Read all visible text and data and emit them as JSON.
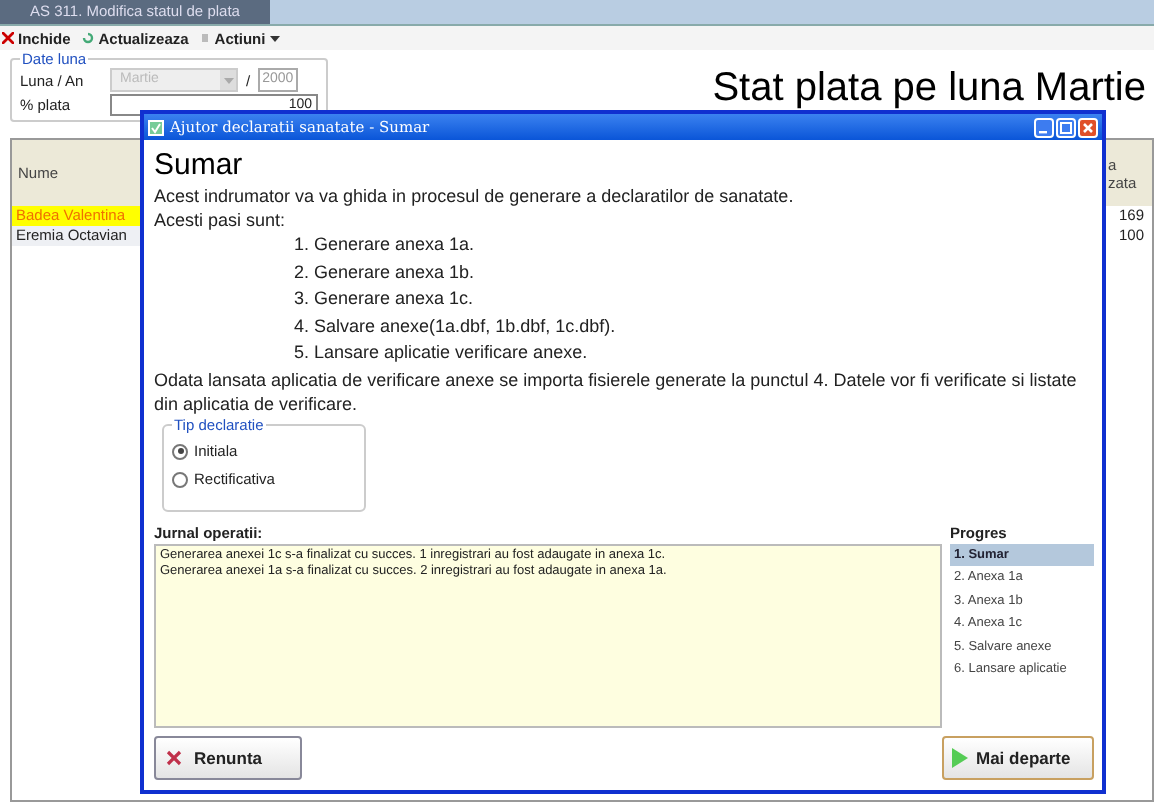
{
  "tab": {
    "label": "AS 311. Modifica statul de plata",
    "selected": true
  },
  "toolbar": [
    {
      "label": "Inchide",
      "kind": "close"
    },
    {
      "label": "Actualizeaza",
      "kind": "refresh"
    },
    {
      "label": "Actiuni",
      "kind": "menu"
    }
  ],
  "date_group": {
    "title": "Date luna",
    "luna_label": "Luna / An",
    "month": "Martie",
    "separator": "/",
    "year": "2000",
    "plata_label": "% plata",
    "plata": "100"
  },
  "page_title": "Stat plata pe luna Martie",
  "grid": {
    "columns": [
      "Nume",
      "a\nzata"
    ],
    "rows": [
      {
        "cells": [
          "Badea Valentina",
          "169"
        ],
        "selected": true
      },
      {
        "cells": [
          "Eremia Octavian",
          "100"
        ],
        "selected": false
      }
    ]
  },
  "dialog": {
    "title": "Ajutor declaratii sanatate - Sumar",
    "heading": "Sumar",
    "intro": [
      "Acest indrumator va va ghida  in procesul de generare a declaratilor de sanatate.",
      "Acesti pasi sunt:"
    ],
    "steps": [
      "1. Generare anexa 1a.",
      "2. Generare anexa 1b.",
      "3. Generare anexa 1c.",
      "4. Salvare anexe(1a.dbf, 1b.dbf, 1c.dbf).",
      "5. Lansare aplicatie verificare anexe."
    ],
    "note": "Odata lansata aplicatia de verificare anexe se importa fisierele generate la punctul 4. Datele vor fi verificate si listate din aplicatia de verificare.",
    "declaration_type": {
      "title": "Tip declaratie",
      "options": [
        {
          "label": "Initiala",
          "selected": true
        },
        {
          "label": "Rectificativa",
          "selected": false
        }
      ]
    },
    "log_label": "Jurnal operatii:",
    "log": [
      "Generarea anexei 1c s-a finalizat cu succes. 1 inregistrari au fost adaugate in anexa 1c.",
      "Generarea anexei 1a s-a finalizat cu succes. 2 inregistrari au fost adaugate in anexa 1a."
    ],
    "progress_label": "Progres",
    "progress": [
      {
        "label": "1. Sumar",
        "selected": true
      },
      {
        "label": "2. Anexa 1a",
        "selected": false
      },
      {
        "label": "3. Anexa 1b",
        "selected": false
      },
      {
        "label": "4. Anexa 1c",
        "selected": false
      },
      {
        "label": "5. Salvare anexe",
        "selected": false
      },
      {
        "label": "6. Lansare aplicatie",
        "selected": false
      }
    ],
    "cancel_button": "Renunta",
    "next_button": "Mai departe"
  }
}
